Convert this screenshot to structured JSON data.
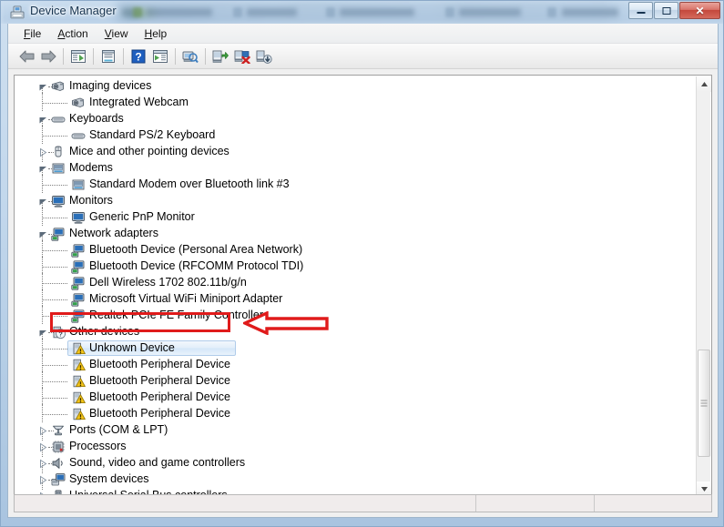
{
  "window": {
    "title": "Device Manager",
    "icon": "device-manager-icon",
    "controls": {
      "minimize": "Minimize",
      "maximize": "Maximize",
      "close": "Close"
    }
  },
  "menubar": {
    "items": [
      {
        "label": "File",
        "accel": "F"
      },
      {
        "label": "Action",
        "accel": "A"
      },
      {
        "label": "View",
        "accel": "V"
      },
      {
        "label": "Help",
        "accel": "H"
      }
    ]
  },
  "toolbar": {
    "buttons": [
      {
        "name": "back-icon",
        "tooltip": "Back"
      },
      {
        "name": "forward-icon",
        "tooltip": "Forward"
      },
      {
        "name": "show-hide-console-tree-icon",
        "tooltip": "Show/Hide Console Tree"
      },
      {
        "name": "properties-icon",
        "tooltip": "Properties"
      },
      {
        "name": "help-icon",
        "tooltip": "Help"
      },
      {
        "name": "show-hide-action-pane-icon",
        "tooltip": "Show/Hide Action Pane"
      },
      {
        "name": "scan-for-hardware-changes-icon",
        "tooltip": "Scan for hardware changes"
      },
      {
        "name": "update-driver-icon",
        "tooltip": "Update Driver Software"
      },
      {
        "name": "disable-device-icon",
        "tooltip": "Disable"
      },
      {
        "name": "uninstall-device-icon",
        "tooltip": "Uninstall"
      }
    ]
  },
  "tree": {
    "nodes": [
      {
        "label": "Imaging devices",
        "depth": 0,
        "state": "expanded",
        "icon": "camera-icon",
        "selected": false
      },
      {
        "label": "Integrated Webcam",
        "depth": 1,
        "state": "leaf",
        "icon": "camera-icon",
        "selected": false
      },
      {
        "label": "Keyboards",
        "depth": 0,
        "state": "expanded",
        "icon": "keyboard-icon",
        "selected": false
      },
      {
        "label": "Standard PS/2 Keyboard",
        "depth": 1,
        "state": "leaf",
        "icon": "keyboard-icon",
        "selected": false
      },
      {
        "label": "Mice and other pointing devices",
        "depth": 0,
        "state": "collapsed",
        "icon": "mouse-icon",
        "selected": false
      },
      {
        "label": "Modems",
        "depth": 0,
        "state": "expanded",
        "icon": "modem-icon",
        "selected": false
      },
      {
        "label": "Standard Modem over Bluetooth link #3",
        "depth": 1,
        "state": "leaf",
        "icon": "modem-icon",
        "selected": false
      },
      {
        "label": "Monitors",
        "depth": 0,
        "state": "expanded",
        "icon": "monitor-icon",
        "selected": false
      },
      {
        "label": "Generic PnP Monitor",
        "depth": 1,
        "state": "leaf",
        "icon": "monitor-icon",
        "selected": false
      },
      {
        "label": "Network adapters",
        "depth": 0,
        "state": "expanded",
        "icon": "network-icon",
        "selected": false
      },
      {
        "label": "Bluetooth Device (Personal Area Network)",
        "depth": 1,
        "state": "leaf",
        "icon": "network-icon",
        "selected": false
      },
      {
        "label": "Bluetooth Device (RFCOMM Protocol TDI)",
        "depth": 1,
        "state": "leaf",
        "icon": "network-icon",
        "selected": false
      },
      {
        "label": "Dell Wireless 1702 802.11b/g/n",
        "depth": 1,
        "state": "leaf",
        "icon": "network-icon",
        "selected": false
      },
      {
        "label": "Microsoft Virtual WiFi Miniport Adapter",
        "depth": 1,
        "state": "leaf",
        "icon": "network-icon",
        "selected": false
      },
      {
        "label": "Realtek PCIe FE Family Controller",
        "depth": 1,
        "state": "leaf",
        "icon": "network-icon",
        "selected": false
      },
      {
        "label": "Other devices",
        "depth": 0,
        "state": "expanded",
        "icon": "unknown-device-icon",
        "selected": false
      },
      {
        "label": "Unknown Device",
        "depth": 1,
        "state": "leaf",
        "icon": "warning-device-icon",
        "selected": true
      },
      {
        "label": "Bluetooth Peripheral Device",
        "depth": 1,
        "state": "leaf",
        "icon": "warning-device-icon",
        "selected": false
      },
      {
        "label": "Bluetooth Peripheral Device",
        "depth": 1,
        "state": "leaf",
        "icon": "warning-device-icon",
        "selected": false
      },
      {
        "label": "Bluetooth Peripheral Device",
        "depth": 1,
        "state": "leaf",
        "icon": "warning-device-icon",
        "selected": false
      },
      {
        "label": "Bluetooth Peripheral Device",
        "depth": 1,
        "state": "leaf",
        "icon": "warning-device-icon",
        "selected": false
      },
      {
        "label": "Ports (COM & LPT)",
        "depth": 0,
        "state": "collapsed",
        "icon": "port-icon",
        "selected": false
      },
      {
        "label": "Processors",
        "depth": 0,
        "state": "collapsed",
        "icon": "processor-icon",
        "selected": false
      },
      {
        "label": "Sound, video and game controllers",
        "depth": 0,
        "state": "collapsed",
        "icon": "speaker-icon",
        "selected": false
      },
      {
        "label": "System devices",
        "depth": 0,
        "state": "collapsed",
        "icon": "system-icon",
        "selected": false
      },
      {
        "label": "Universal Serial Bus controllers",
        "depth": 0,
        "state": "collapsed",
        "icon": "usb-icon",
        "selected": false
      }
    ]
  },
  "annotation": {
    "highlight_target": "Unknown Device",
    "highlight_color": "#e01b1b",
    "arrow_direction": "left",
    "arrow_color": "#e01b1b"
  },
  "scrollbar": {
    "up_arrow": "▲",
    "down_arrow": "▼",
    "orientation": "vertical"
  },
  "statusbar": {
    "cells": [
      "",
      "",
      ""
    ]
  },
  "colors": {
    "selection_border": "#b0ccea",
    "selection_fill": "#ddebf9",
    "annotation_red": "#e01b1b",
    "window_glass": "#b4cde5",
    "close_button": "#c4483c"
  }
}
